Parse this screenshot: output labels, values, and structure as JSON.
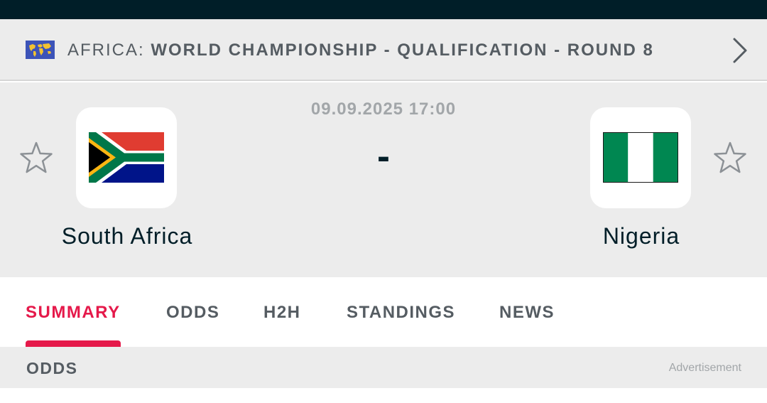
{
  "league": {
    "country": "AFRICA:",
    "name": "WORLD CHAMPIONSHIP - QUALIFICATION - ROUND 8",
    "flag_icon": "world-map-flag-icon",
    "next_icon": "chevron-right-icon"
  },
  "match": {
    "datetime": "09.09.2025 17:00",
    "score": "-"
  },
  "home_team": {
    "name": "South Africa",
    "flag_icon": "south-africa-flag-icon",
    "favorite_icon": "star-outline-icon"
  },
  "away_team": {
    "name": "Nigeria",
    "flag_icon": "nigeria-flag-icon",
    "favorite_icon": "star-outline-icon"
  },
  "tabs": [
    {
      "label": "SUMMARY",
      "active": true
    },
    {
      "label": "ODDS",
      "active": false
    },
    {
      "label": "H2H",
      "active": false
    },
    {
      "label": "STANDINGS",
      "active": false
    },
    {
      "label": "NEWS",
      "active": false
    }
  ],
  "section": {
    "title": "ODDS",
    "ad_label": "Advertisement"
  },
  "colors": {
    "header_dark": "#001e28",
    "accent": "#e5194a",
    "panel_bg": "#ececec",
    "muted_text": "#555c62"
  }
}
